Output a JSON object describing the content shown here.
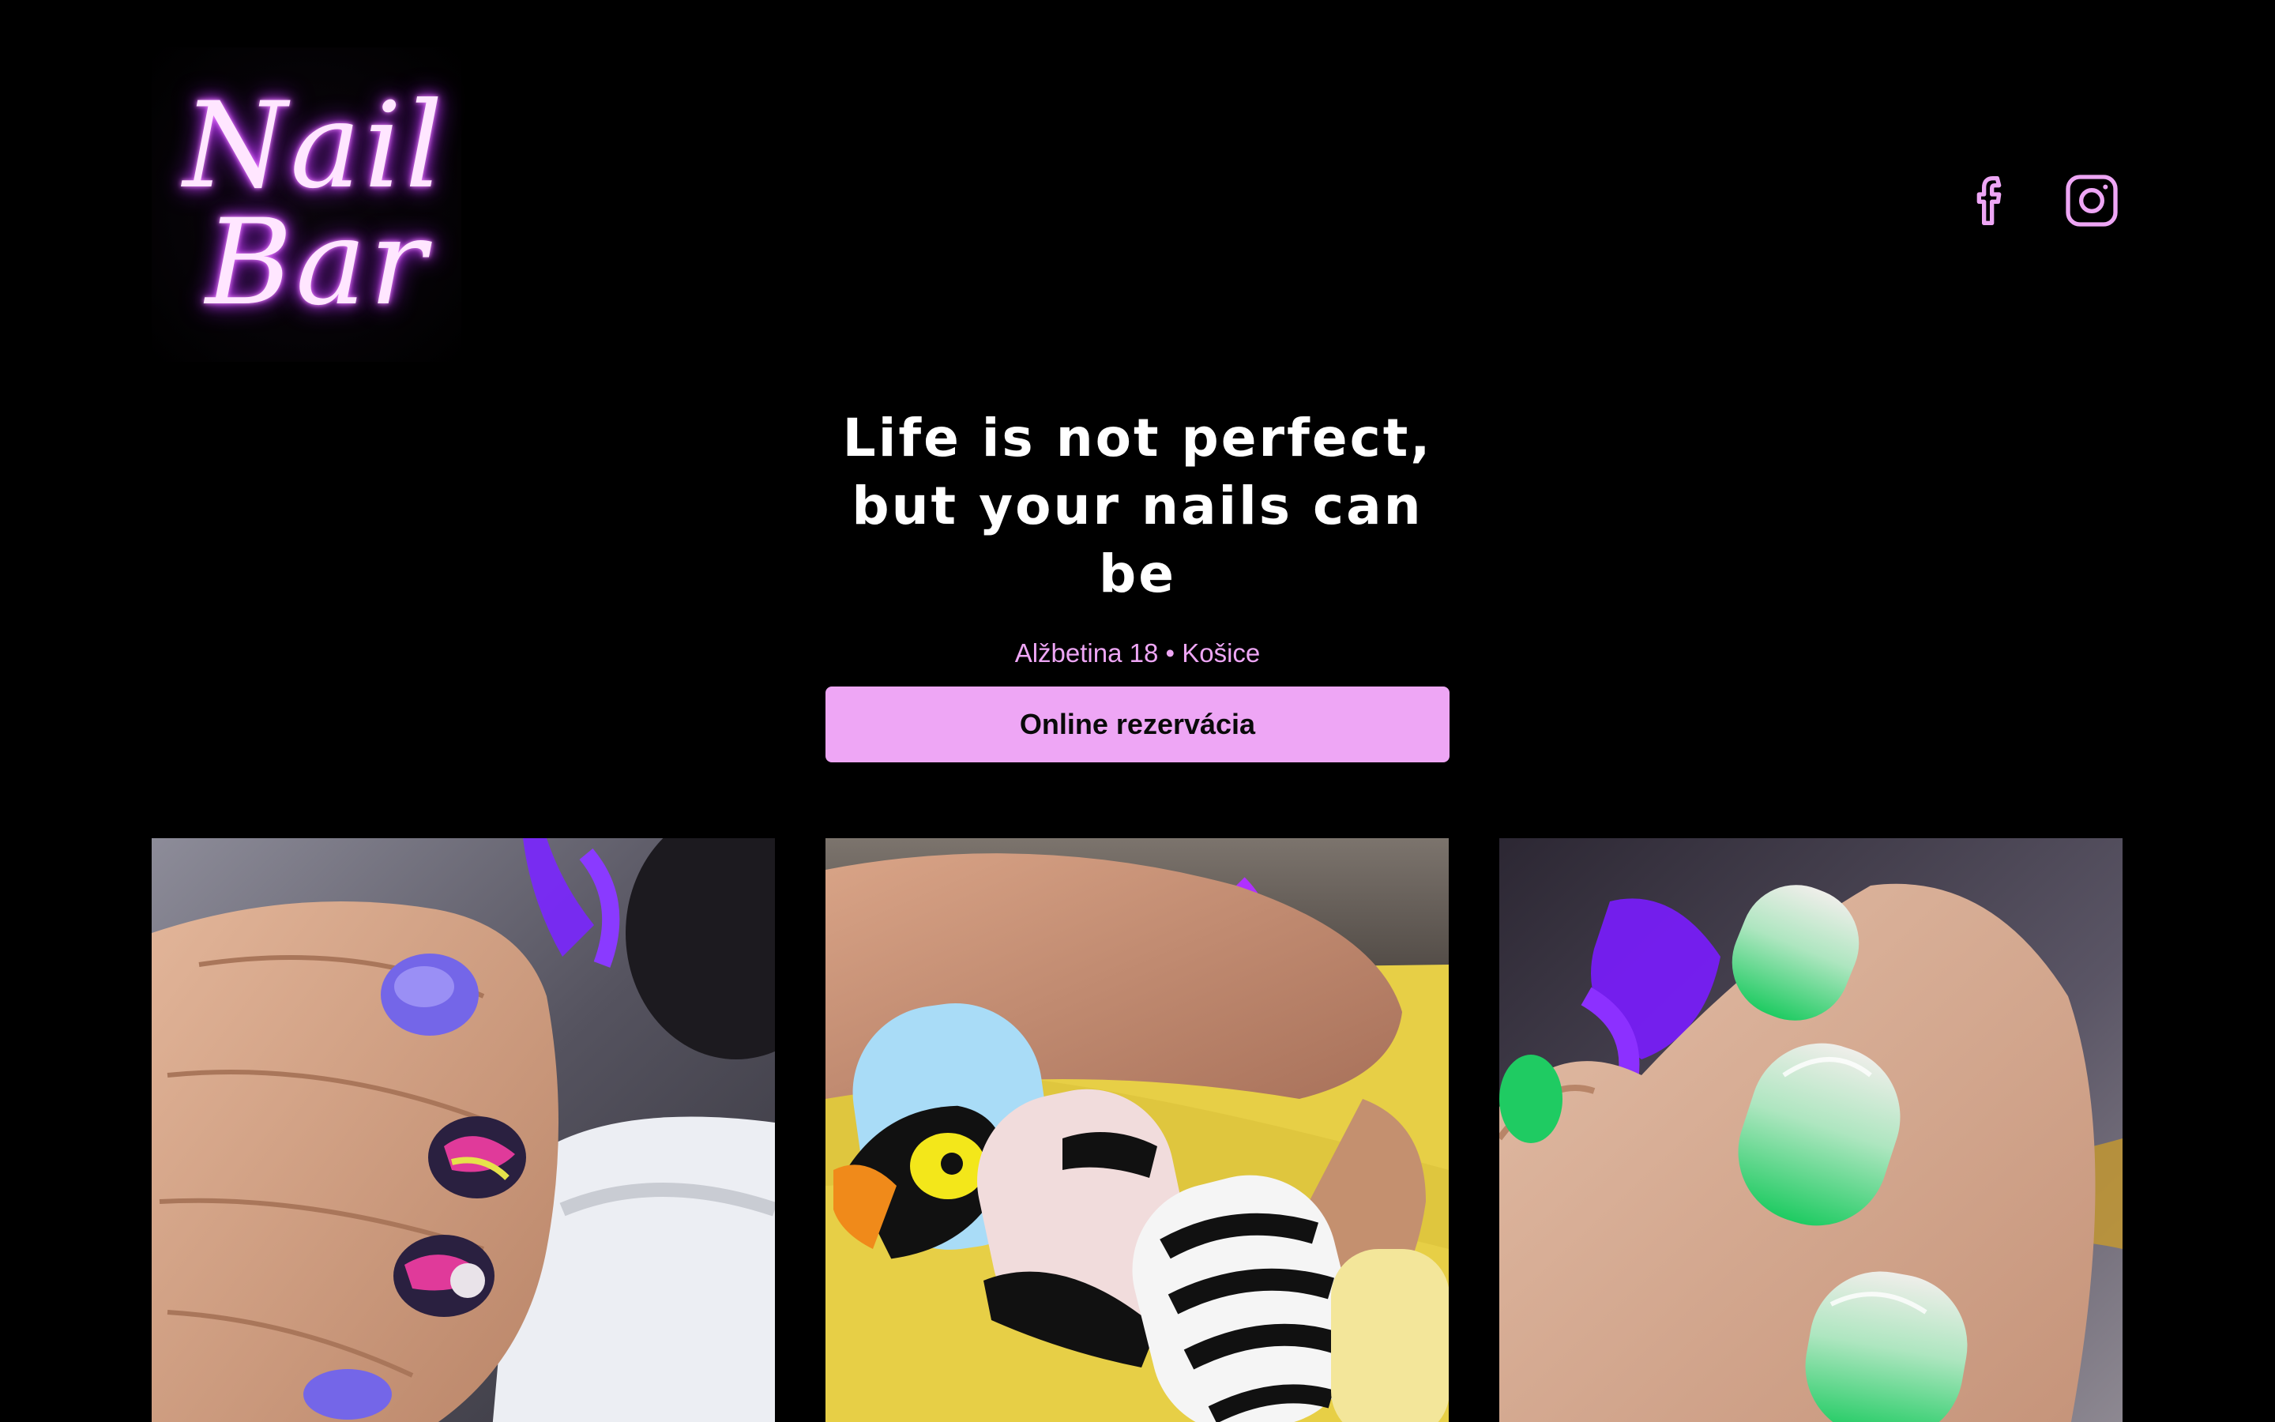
{
  "header": {
    "logo_line1": "Nail",
    "logo_line2": "Bar",
    "social": [
      {
        "icon": "facebook-icon",
        "color": "#eea6f5"
      },
      {
        "icon": "instagram-icon",
        "color": "#eea6f5"
      }
    ]
  },
  "hero": {
    "headline": "Life is not perfect, but your nails can be",
    "address": "Alžbetina 18 • Košice",
    "cta_label": "Online rezervácia"
  },
  "theme": {
    "background": "#000000",
    "accent": "#eea6f5",
    "neon": "#cc44ff"
  },
  "gallery": {
    "photos": [
      {
        "description_icon": "purple-nails-photo"
      },
      {
        "description_icon": "toucan-zebra-nails-photo"
      },
      {
        "description_icon": "green-ombre-nails-photo"
      }
    ]
  }
}
